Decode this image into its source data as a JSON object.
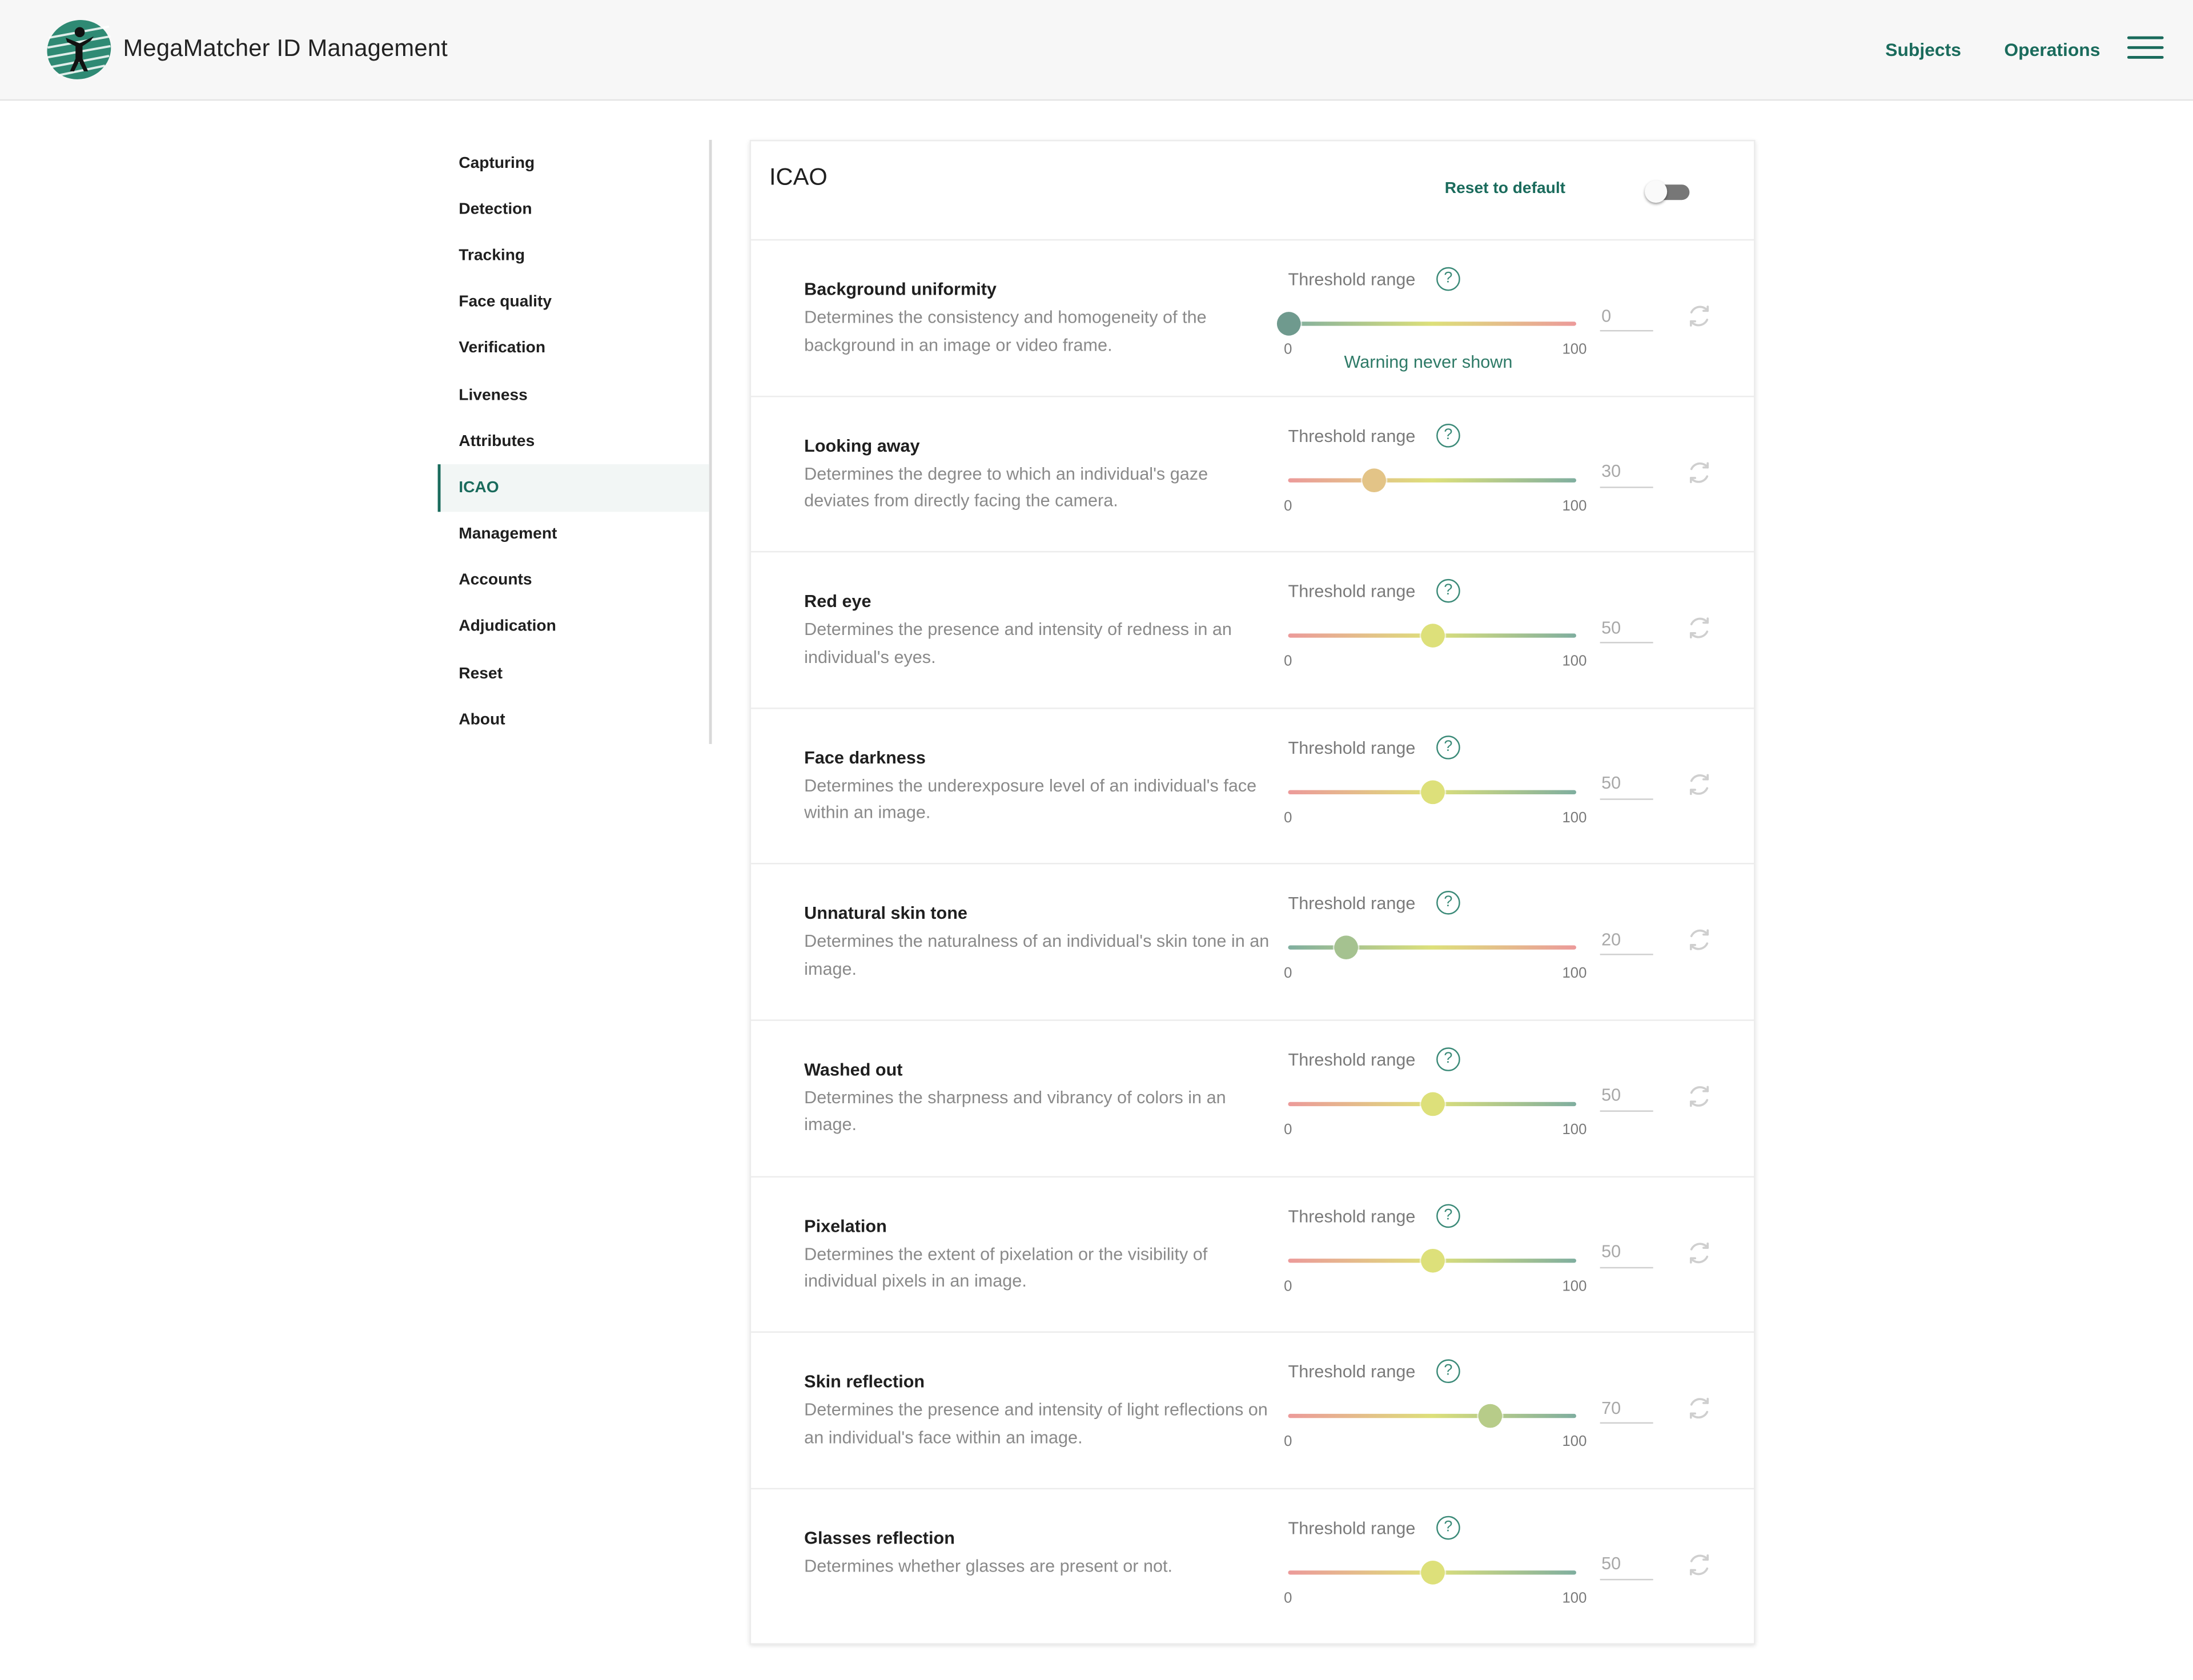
{
  "header": {
    "app_title": "MegaMatcher ID Management",
    "nav": [
      "Subjects",
      "Operations"
    ],
    "logo_icon": "megamatcher-logo",
    "menu_icon": "hamburger-menu-icon",
    "accent_color": "#1a6b5c"
  },
  "sidebar": {
    "items": [
      {
        "label": "Capturing",
        "active": false
      },
      {
        "label": "Detection",
        "active": false
      },
      {
        "label": "Tracking",
        "active": false
      },
      {
        "label": "Face quality",
        "active": false
      },
      {
        "label": "Verification",
        "active": false
      },
      {
        "label": "Liveness",
        "active": false
      },
      {
        "label": "Attributes",
        "active": false
      },
      {
        "label": "ICAO",
        "active": true
      },
      {
        "label": "Management",
        "active": false
      },
      {
        "label": "Accounts",
        "active": false
      },
      {
        "label": "Adjudication",
        "active": false
      },
      {
        "label": "Reset",
        "active": false
      },
      {
        "label": "About",
        "active": false
      }
    ]
  },
  "panel": {
    "title": "ICAO",
    "reset_label": "Reset to default",
    "toggle_on": false,
    "threshold_label": "Threshold range",
    "help_glyph": "?",
    "min_label": "0",
    "max_label": "100",
    "rows": [
      {
        "title": "Background uniformity",
        "desc": "Determines the consistency and homogeneity of the background in an image or video frame.",
        "value": "0",
        "gradient": "green-yellow-red",
        "warning": "Warning never shown"
      },
      {
        "title": "Looking away",
        "desc": "Determines the degree to which an individual's gaze deviates from directly facing the camera.",
        "value": "30",
        "gradient": "red-yellow-green",
        "warning": ""
      },
      {
        "title": "Red eye",
        "desc": "Determines the presence and intensity of redness in an individual's eyes.",
        "value": "50",
        "gradient": "red-yellow-green",
        "warning": ""
      },
      {
        "title": "Face darkness",
        "desc": "Determines the underexposure level of an individual's face within an image.",
        "value": "50",
        "gradient": "red-yellow-green",
        "warning": ""
      },
      {
        "title": "Unnatural skin tone",
        "desc": "Determines the naturalness of an individual's skin tone in an image.",
        "value": "20",
        "gradient": "green-yellow-red",
        "warning": ""
      },
      {
        "title": "Washed out",
        "desc": "Determines the sharpness and vibrancy of colors in an image.",
        "value": "50",
        "gradient": "red-yellow-green",
        "warning": ""
      },
      {
        "title": "Pixelation",
        "desc": "Determines the extent of pixelation or the visibility of individual pixels in an image.",
        "value": "50",
        "gradient": "red-yellow-green",
        "warning": ""
      },
      {
        "title": "Skin reflection",
        "desc": "Determines the presence and intensity of light reflections on an individual's face within an image.",
        "value": "70",
        "gradient": "red-yellow-green",
        "warning": ""
      },
      {
        "title": "Glasses reflection",
        "desc": "Determines whether glasses are present or not.",
        "value": "50",
        "gradient": "red-yellow-green",
        "warning": ""
      }
    ]
  },
  "colors": {
    "red": "#ec9a9a",
    "yellow": "#dde07a",
    "green": "#7fae9f",
    "thumb_green": "#6f9a8e"
  }
}
